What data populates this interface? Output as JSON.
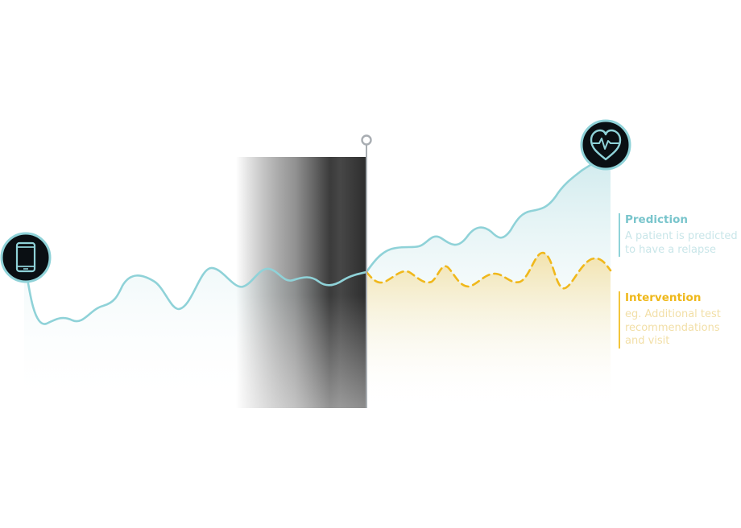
{
  "legend": {
    "prediction": {
      "title": "Prediction",
      "description": "A patient is predicted\nto have a relapse",
      "color": "#8fd2d8"
    },
    "intervention": {
      "title": "Intervention",
      "description": "eg. Additional test\nrecommendations\nand visit",
      "color": "#f3c53a"
    }
  },
  "icons": {
    "start": "smartphone-icon",
    "end": "heart-pulse-icon",
    "marker": "timeline-marker-pin"
  }
}
